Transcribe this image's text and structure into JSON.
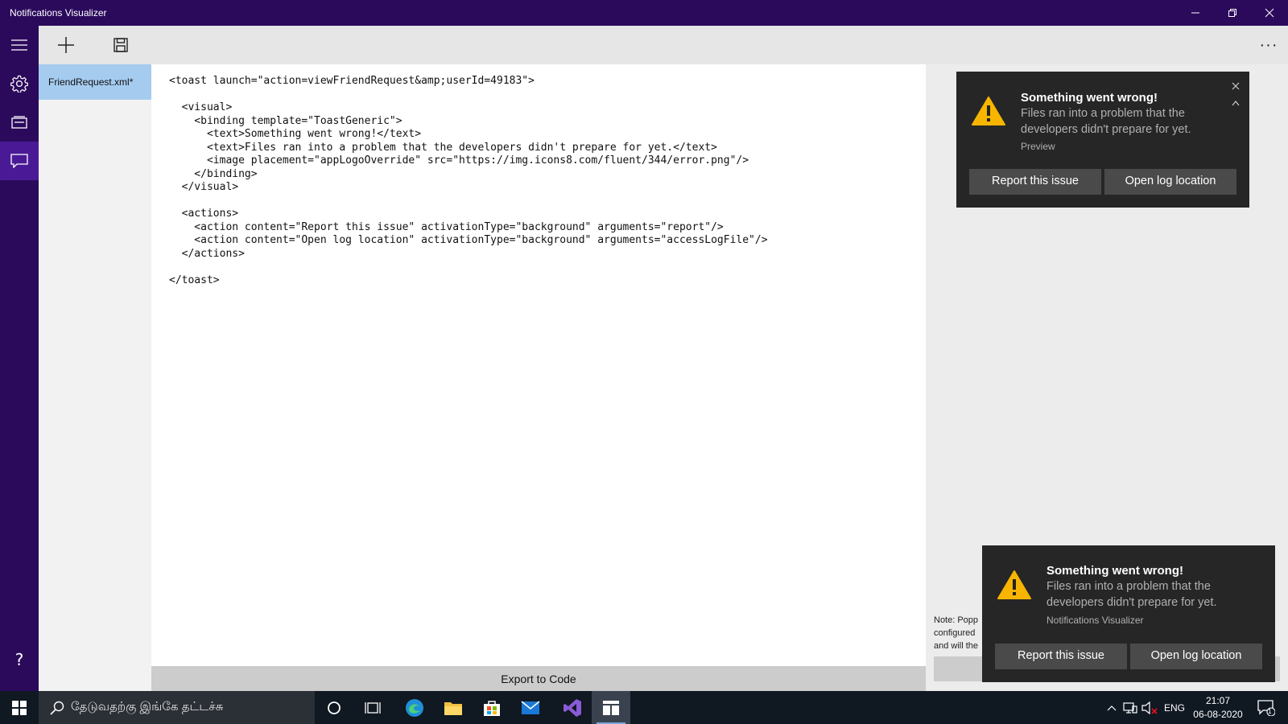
{
  "window": {
    "title": "Notifications Visualizer"
  },
  "file": {
    "name": "FriendRequest.xml*"
  },
  "editor": {
    "code": "<toast launch=\"action=viewFriendRequest&amp;userId=49183\">\n\n  <visual>\n    <binding template=\"ToastGeneric\">\n      <text>Something went wrong!</text>\n      <text>Files ran into a problem that the developers didn't prepare for yet.</text>\n      <image placement=\"appLogoOverride\" src=\"https://img.icons8.com/fluent/344/error.png\"/>\n    </binding>\n  </visual>\n\n  <actions>\n    <action content=\"Report this issue\" activationType=\"background\" arguments=\"report\"/>\n    <action content=\"Open log location\" activationType=\"background\" arguments=\"accessLogFile\"/>\n  </actions>\n\n</toast>"
  },
  "export_label": "Export to Code",
  "preview_toast": {
    "title": "Something went wrong!",
    "body": "Files ran into a problem that the developers didn't prepare for yet.",
    "attribution": "Preview",
    "button1": "Report this issue",
    "button2": "Open log location"
  },
  "popup_toast": {
    "title": "Something went wrong!",
    "body": "Files ran into a problem that the developers didn't prepare for yet.",
    "attribution": "Notifications Visualizer",
    "button1": "Report this issue",
    "button2": "Open log location"
  },
  "note": {
    "text": "Note: Popp configured and will the"
  },
  "taskbar": {
    "search_placeholder": "தேடுவதற்கு இங்கே தட்டச்சு",
    "language": "ENG",
    "time": "21:07",
    "date": "06-08-2020",
    "notification_count": "1"
  },
  "icons": {
    "nav": [
      "hamburger-icon",
      "settings-icon",
      "tiles-icon",
      "notifications-icon",
      "help-icon"
    ],
    "toolbar": [
      "add-icon",
      "save-icon",
      "more-icon"
    ]
  },
  "colors": {
    "titlebar": "#2b0a5c",
    "nav_active": "#4a1a96",
    "file_selected": "#a5cbef",
    "toast_bg": "#262626",
    "toast_button": "#4a4a4a",
    "warning": "#f7b500",
    "taskbar": "#101822"
  }
}
